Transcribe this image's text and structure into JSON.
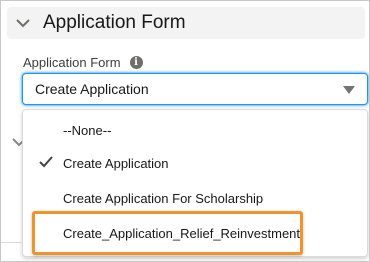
{
  "section": {
    "title": "Application Form",
    "icon": "chevron-down-icon"
  },
  "field": {
    "label": "Application Form",
    "info_icon": "info-icon",
    "info_glyph": "i",
    "selected_value": "Create Application"
  },
  "dropdown": {
    "options": [
      {
        "label": "--None--",
        "selected": false
      },
      {
        "label": "Create Application",
        "selected": true
      },
      {
        "label": "Create Application For Scholarship",
        "selected": false
      },
      {
        "label": "Create_Application_Relief_Reinvestment",
        "selected": false,
        "highlighted": true
      }
    ]
  },
  "colors": {
    "focus_border": "#1b96ff",
    "highlight_border": "#f0932b",
    "header_bg": "#f3f3f3"
  }
}
